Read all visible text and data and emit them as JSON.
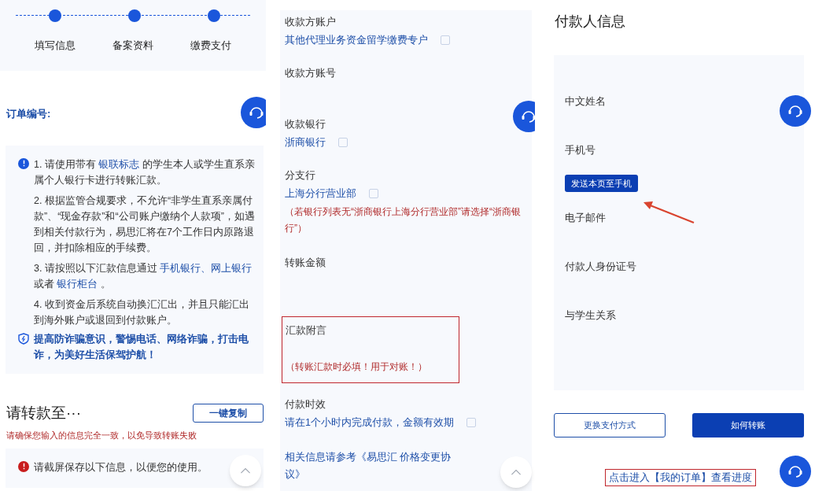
{
  "steps": [
    {
      "label": "填写信息"
    },
    {
      "label": "备案资料"
    },
    {
      "label": "缴费支付"
    }
  ],
  "order": {
    "label": "订单编号:"
  },
  "notice": {
    "items": [
      [
        {
          "kind": "text",
          "text": "1. 请使用带有 "
        },
        {
          "kind": "link",
          "text": "银联标志"
        },
        {
          "kind": "text",
          "text": " 的学生本人或学生直系亲属个人银行卡进行转账汇款。"
        }
      ],
      [
        {
          "kind": "text",
          "text": "2. 根据监管合规要求，不允许“非学生直系亲属付款”、“现金存款”和“公司账户缴纳个人款项”，如遇到相关付款行为，易思汇将在7个工作日内原路退回，并扣除相应的手续费。"
        }
      ],
      [
        {
          "kind": "text",
          "text": "3. 请按照以下汇款信息通过 "
        },
        {
          "kind": "link",
          "text": "手机银行、网上银行"
        },
        {
          "kind": "text",
          "text": " 或者 "
        },
        {
          "kind": "link",
          "text": "银行柜台"
        },
        {
          "kind": "text",
          "text": " 。"
        }
      ],
      [
        {
          "kind": "text",
          "text": "4. 收到资金后系统自动换汇汇出，并且只能汇出到海外账户或退回到付款账户。"
        }
      ]
    ],
    "warning": "提高防诈骗意识，警惕电话、网络诈骗，打击电诈，为美好生活保驾护航！"
  },
  "transfer": {
    "title": "请转款至···",
    "copy_button": "一键复制",
    "caution": "请确保您输入的信息完全一致，以免导致转账失败",
    "screenshot_tip": "请截屏保存以下信息，以便您的使用。"
  },
  "payee_fields": [
    {
      "label": "收款方账户",
      "value": "其他代理业务资金留学缴费专户",
      "copyable": true,
      "highlighted": false
    },
    {
      "label": "收款方账号",
      "copyable": false,
      "highlighted": false
    },
    {
      "label": "收款银行",
      "value": "浙商银行",
      "copyable": true,
      "highlighted": false
    },
    {
      "label": "分支行",
      "value": "上海分行营业部",
      "copyable": true,
      "note": "（若银行列表无“浙商银行上海分行营业部”请选择“浙商银行”）",
      "highlighted": false
    },
    {
      "label": "转账金额",
      "copyable": false,
      "highlighted": false
    },
    {
      "label": "汇款附言",
      "note": "（转账汇款时必填！用于对账！）",
      "copyable": false,
      "highlighted": true
    },
    {
      "label": "付款时效",
      "value": "请在1个小时内完成付款，金额有效期",
      "copyable": true,
      "highlighted": false
    }
  ],
  "agreement": "相关信息请参考《易思汇 价格变更协议》",
  "payer": {
    "title": "付款人信息",
    "rows": [
      {
        "kind": "field",
        "label": "中文姓名"
      },
      {
        "kind": "field",
        "label": "手机号"
      },
      {
        "kind": "button",
        "label": "发送本页至手机"
      },
      {
        "kind": "field",
        "label": "电子邮件"
      },
      {
        "kind": "field",
        "label": "付款人身份证号"
      },
      {
        "kind": "field",
        "label": "与学生关系"
      }
    ]
  },
  "buttons": [
    {
      "label": "更换支付方式",
      "primary": false
    },
    {
      "label": "如何转账",
      "primary": true
    }
  ],
  "order_link": {
    "text": "点击进入【我的订单】查看进度",
    "highlighted": true
  }
}
